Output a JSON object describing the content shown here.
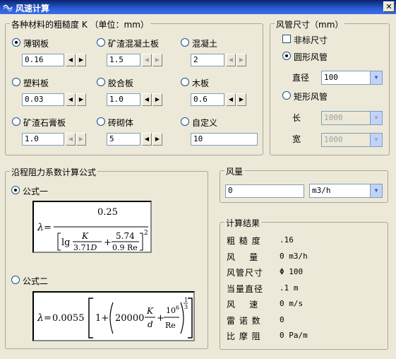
{
  "window": {
    "title": "风速计算",
    "close_glyph": "✕"
  },
  "roughness": {
    "legend": "各种材料的粗糙度 K （单位：mm）",
    "materials": [
      {
        "label": "薄钢板",
        "value": "0.16",
        "selected": true,
        "disabled": false
      },
      {
        "label": "矿渣混凝土板",
        "value": "1.5",
        "selected": false,
        "disabled": true
      },
      {
        "label": "混凝土",
        "value": "2",
        "selected": false,
        "disabled": true
      },
      {
        "label": "塑料板",
        "value": "0.03",
        "selected": false,
        "disabled": false
      },
      {
        "label": "胶合板",
        "value": "1.0",
        "selected": false,
        "disabled": false
      },
      {
        "label": "木板",
        "value": "0.6",
        "selected": false,
        "disabled": false
      },
      {
        "label": "矿渣石膏板",
        "value": "1.0",
        "selected": false,
        "disabled": true
      },
      {
        "label": "砖砌体",
        "value": "5",
        "selected": false,
        "disabled": false
      },
      {
        "label": "自定义",
        "value": "10",
        "selected": false,
        "disabled": false
      }
    ]
  },
  "duct": {
    "legend": "风管尺寸（mm）",
    "nonstandard_label": "非标尺寸",
    "round_label": "圆形风管",
    "diameter_label": "直径",
    "diameter_value": "100",
    "rect_label": "矩形风管",
    "length_label": "长",
    "length_value": "1000",
    "width_label": "宽",
    "width_value": "1000"
  },
  "formula": {
    "legend": "沿程阻力系数计算公式",
    "option1_label": "公式一",
    "option2_label": "公式二"
  },
  "airflow": {
    "legend": "风量",
    "value": "0",
    "unit": "m3/h"
  },
  "results": {
    "legend": "计算结果",
    "rows": [
      {
        "label": "粗 糙 度",
        "value": ".16"
      },
      {
        "label": "风    量",
        "value": "0 m3/h"
      },
      {
        "label": "风管尺寸",
        "value": "Φ 100"
      },
      {
        "label": "当量直径",
        "value": ".1 m"
      },
      {
        "label": "风    速",
        "value": "0 m/s"
      },
      {
        "label": "雷 诺 数",
        "value": "0"
      },
      {
        "label": "比 摩 阻",
        "value": "0 Pa/m"
      }
    ]
  }
}
